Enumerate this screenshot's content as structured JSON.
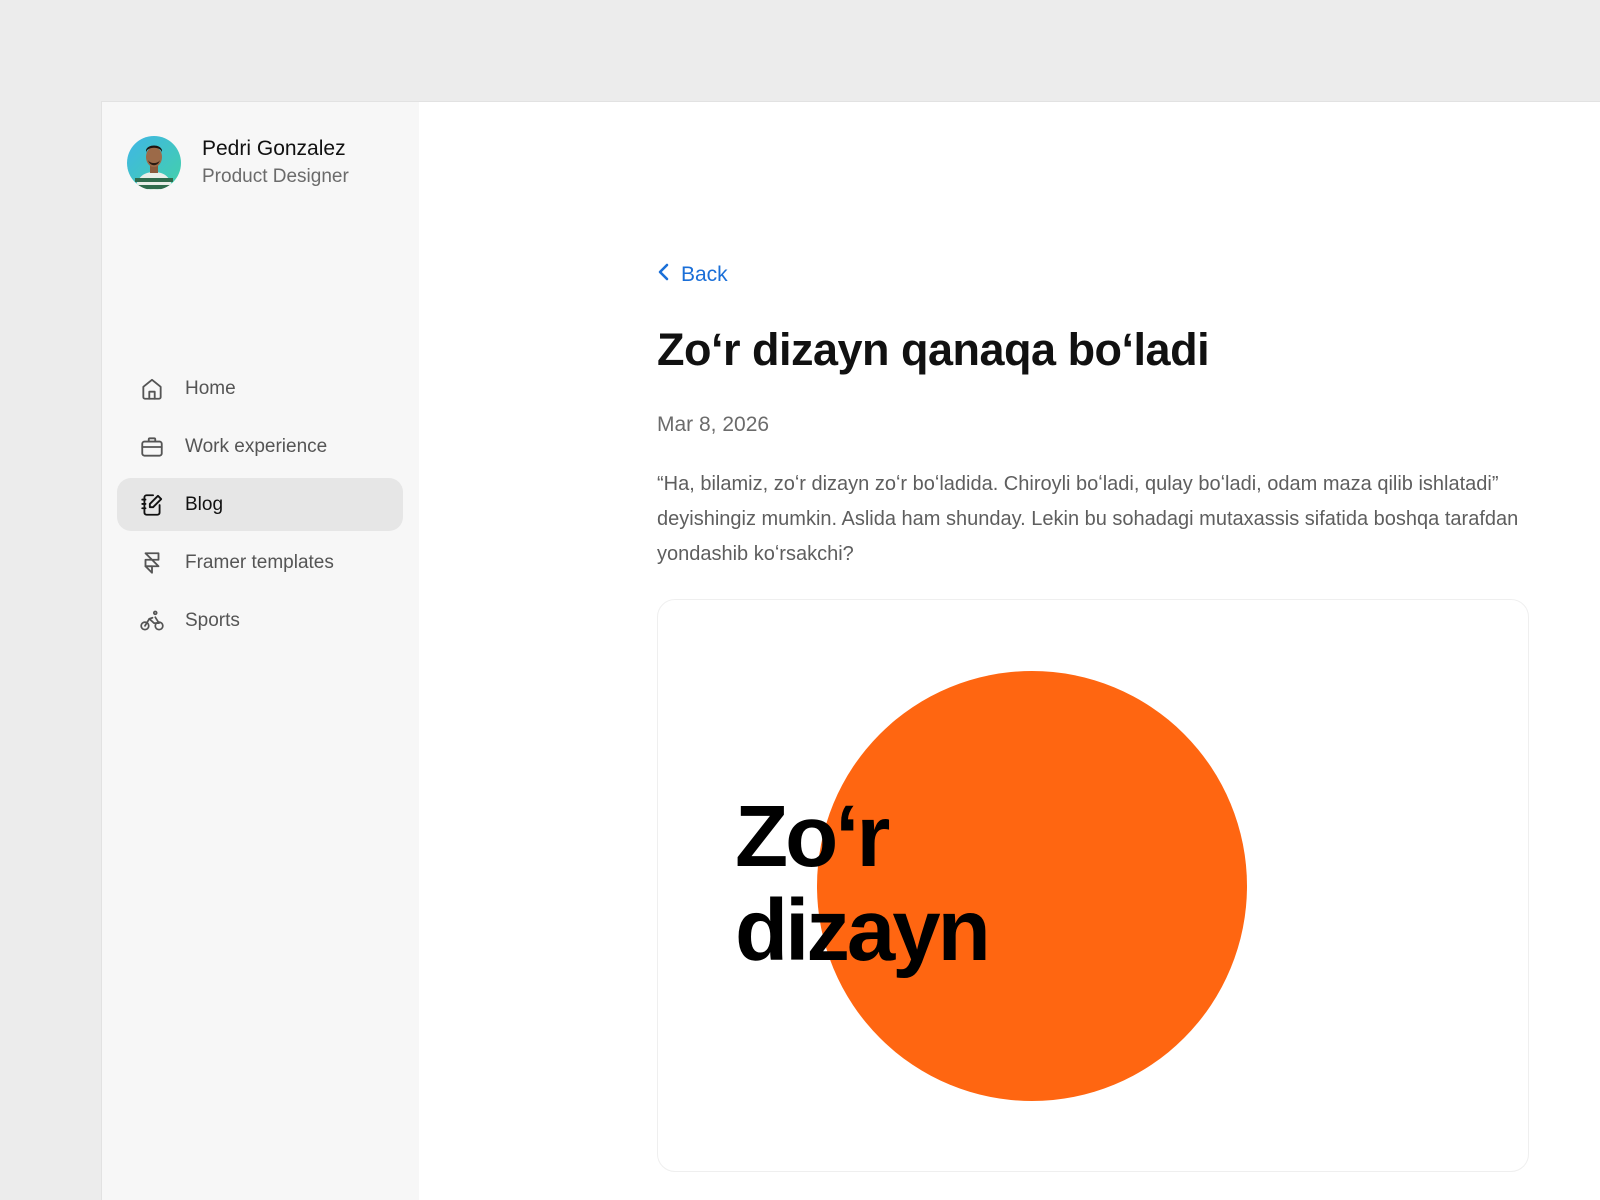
{
  "profile": {
    "name": "Pedri Gonzalez",
    "role": "Product Designer"
  },
  "nav": {
    "items": [
      {
        "label": "Home",
        "icon": "home-icon"
      },
      {
        "label": "Work experience",
        "icon": "briefcase-icon"
      },
      {
        "label": "Blog",
        "icon": "notebook-edit-icon",
        "active": true
      },
      {
        "label": "Framer templates",
        "icon": "framer-icon"
      },
      {
        "label": "Sports",
        "icon": "bicycle-icon"
      }
    ]
  },
  "article": {
    "back_label": "Back",
    "title": "Zoʻr dizayn qanaqa boʻladi",
    "date": "Mar 8, 2026",
    "excerpt": "“Ha, bilamiz, zoʻr dizayn zoʻr boʻladida. Chiroyli boʻladi, qulay boʻladi, odam maza qilib ishlatadi” deyishingiz mumkin. Aslida ham shunday. Lekin bu sohadagi mutaxassis sifatida boshqa tarafdan yondashib koʻrsakchi?",
    "cover": {
      "line1": "Zoʻr",
      "line2": "dizayn",
      "accent_color": "#ff6611"
    }
  },
  "colors": {
    "link": "#1a6fd8",
    "sidebar_bg": "#f7f7f7",
    "active_bg": "#e6e6e6"
  }
}
